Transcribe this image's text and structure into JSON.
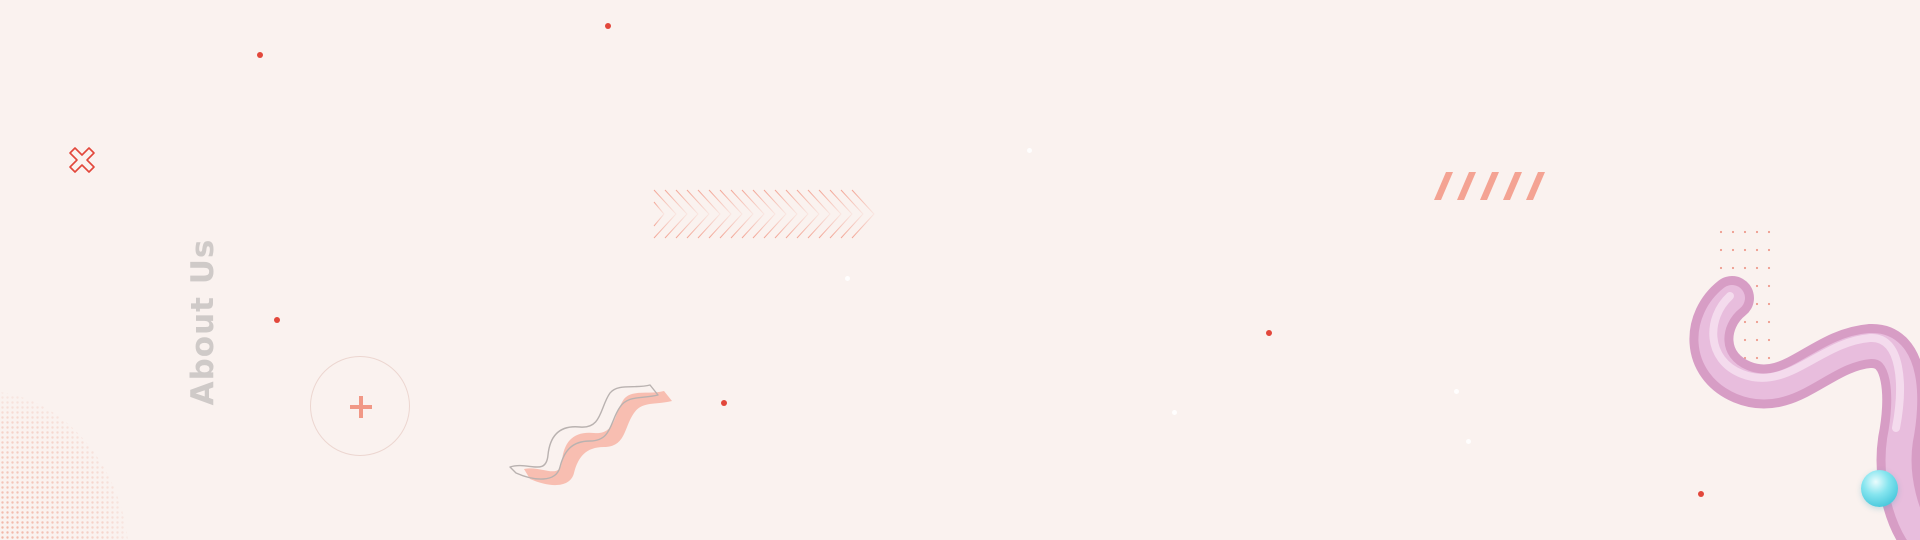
{
  "page": {
    "section_title": "About Us",
    "background_color": "#faf2ef",
    "accent_red": "#e2473b",
    "accent_coral": "#f4a393",
    "tube_color": "#dfa8cf",
    "sphere_color": "#3cc3d8"
  },
  "decorations": {
    "circle_icon": "plus-icon",
    "corner_icon": "cross-outline-icon"
  }
}
